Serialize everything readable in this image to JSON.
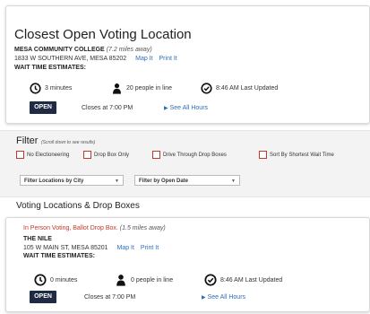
{
  "closest": {
    "title": "Closest Open Voting Location",
    "name": "MESA COMMUNITY COLLEGE",
    "distance": "(7.2 miles away)",
    "address": "1833 W SOUTHERN AVE, MESA 85202",
    "map_link": "Map It",
    "print_link": "Print It",
    "wait_label": "WAIT TIME ESTIMATES:",
    "wait_time": "3 minutes",
    "people": "20 people in line",
    "updated": "8:46 AM Last Updated",
    "status": "OPEN",
    "closes": "Closes at 7:00 PM",
    "see_all": "See All Hours"
  },
  "filter": {
    "title": "Filter",
    "note": "(Scroll down to see results)",
    "checkboxes": [
      "No Electioneering",
      "Drop Box Only",
      "Drive Through Drop Boxes",
      "Sort By Shortest Wait Time"
    ],
    "city_select": "Filter Locations by City",
    "date_select": "Filter by Open Date"
  },
  "section_title": "Voting Locations & Drop Boxes",
  "location": {
    "type": "In Person Voting, Ballot Drop Box.",
    "distance": "(1.5 miles away)",
    "name": "THE NILE",
    "address": "105 W MAIN ST, MESA 85201",
    "map_link": "Map It",
    "print_link": "Print It",
    "wait_label": "WAIT TIME ESTIMATES:",
    "wait_time": "0 minutes",
    "people": "0 people in line",
    "updated": "8:46 AM Last Updated",
    "status": "OPEN",
    "closes": "Closes at 7:00 PM",
    "see_all": "See All Hours"
  },
  "colors": {
    "accent": "#c0392b",
    "link": "#2f6fb7",
    "badge": "#1f2a44"
  },
  "icons": [
    "clock-icon",
    "person-icon",
    "check-circle-icon",
    "triangle-right-icon",
    "dropdown-arrow-icon"
  ]
}
